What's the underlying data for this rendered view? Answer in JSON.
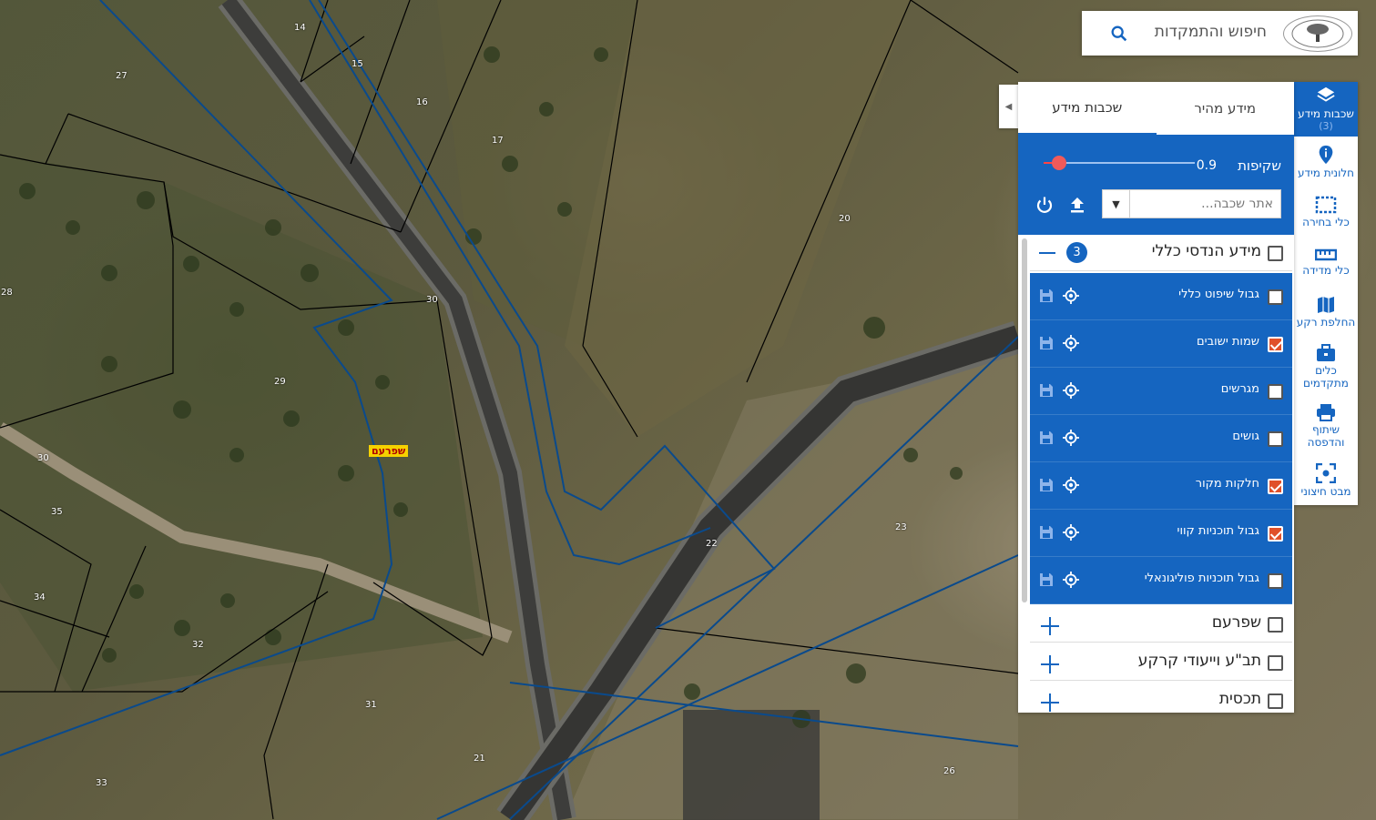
{
  "search": {
    "placeholder": "חיפוש והתמקדות"
  },
  "sidenav": {
    "items": [
      {
        "label": "שכבות מידע",
        "count": "(3)"
      },
      {
        "label": "חלונית מידע"
      },
      {
        "label": "כלי בחירה"
      },
      {
        "label": "כלי מדידה"
      },
      {
        "label": "החלפת רקע"
      },
      {
        "label": "כלים מתקדמים"
      },
      {
        "label": "שיתוף והדפסה"
      },
      {
        "label": "מבט חיצוני"
      }
    ]
  },
  "panel": {
    "tabs": [
      {
        "label": "מידע מהיר"
      },
      {
        "label": "שכבות מידע"
      }
    ],
    "opacity": {
      "label": "שקיפות",
      "value": "0.9",
      "fraction": 0.9
    },
    "layer_search": {
      "placeholder": "אתר שכבה..."
    },
    "groups": [
      {
        "title": "מידע הנדסי כללי",
        "count": "3",
        "expanded": true,
        "layers": [
          {
            "label": "גבול שיפוט כללי",
            "checked": false
          },
          {
            "label": "שמות ישובים",
            "checked": true
          },
          {
            "label": "מגרשים",
            "checked": false
          },
          {
            "label": "גושים",
            "checked": false
          },
          {
            "label": "חלקות מקור",
            "checked": true
          },
          {
            "label": "גבול תוכניות קווי",
            "checked": true
          },
          {
            "label": "גבול תוכניות פוליגונאלי",
            "checked": false
          }
        ]
      },
      {
        "title": "שפרעם",
        "expanded": false
      },
      {
        "title": "תב\"ע וייעודי קרקע",
        "expanded": false
      },
      {
        "title": "תכסית",
        "expanded": false
      }
    ]
  },
  "map": {
    "place_label": "שפרעם",
    "parcel_numbers": [
      "14",
      "15",
      "16",
      "17",
      "27",
      "20",
      "28",
      "30",
      "29",
      "30",
      "35",
      "34",
      "32",
      "31",
      "33",
      "21",
      "22",
      "23",
      "26"
    ]
  },
  "colors": {
    "accent": "#1565c0",
    "checked": "#e0502a",
    "parcel_line": "#000000",
    "plan_line": "#0a4a8c"
  }
}
